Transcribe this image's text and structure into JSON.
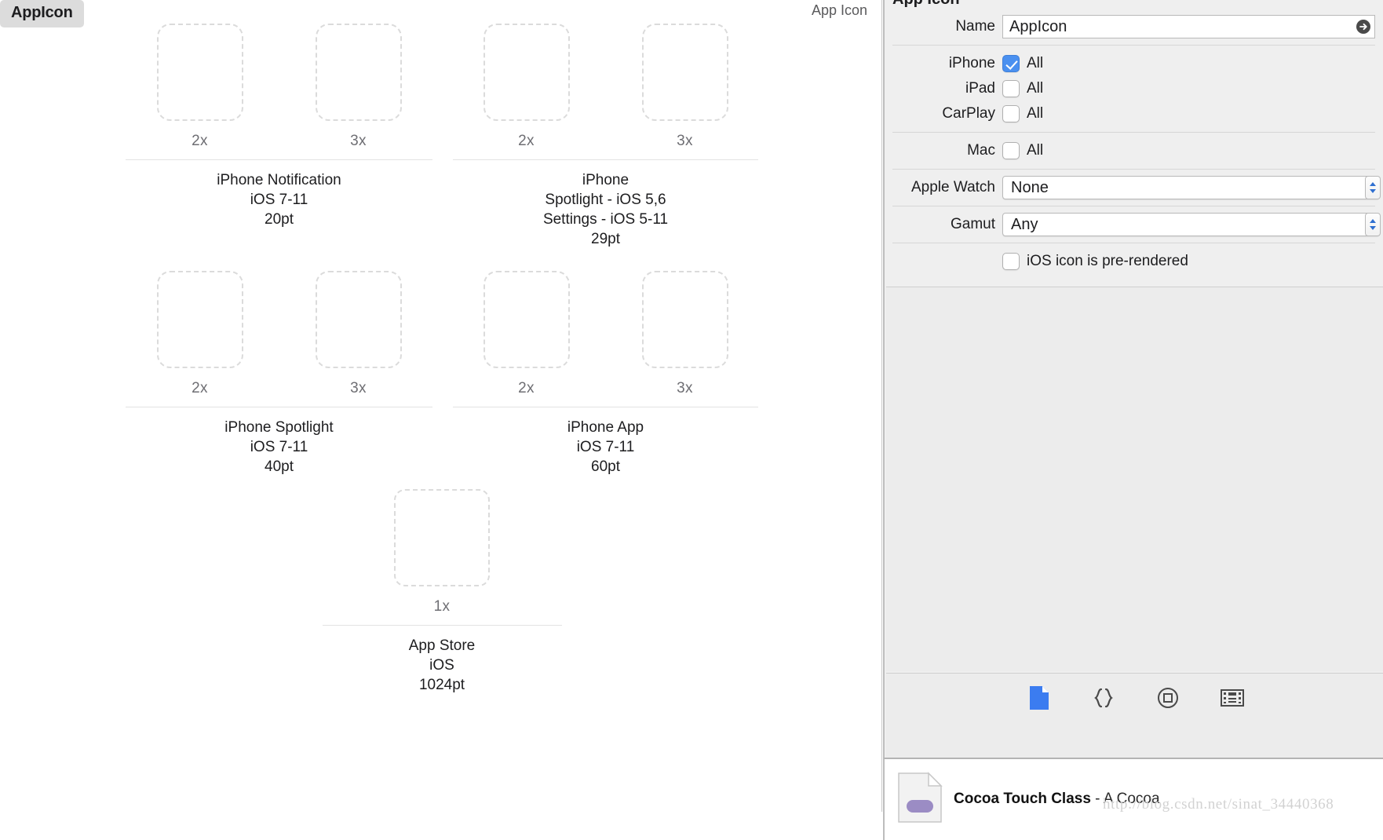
{
  "canvas": {
    "asset_chip_label": "AppIcon",
    "title": "App Icon",
    "groups": [
      {
        "id": "iphone-notification",
        "slots": [
          {
            "scale": "2x",
            "size": "small"
          },
          {
            "scale": "3x",
            "size": "small"
          }
        ],
        "caption_lines": [
          "iPhone Notification",
          "iOS 7-11",
          "20pt"
        ]
      },
      {
        "id": "iphone-spotlight-settings",
        "slots": [
          {
            "scale": "2x",
            "size": "small"
          },
          {
            "scale": "3x",
            "size": "small"
          }
        ],
        "caption_lines": [
          "iPhone",
          "Spotlight - iOS 5,6",
          "Settings - iOS 5-11",
          "29pt"
        ]
      },
      {
        "id": "iphone-spotlight",
        "slots": [
          {
            "scale": "2x",
            "size": "small"
          },
          {
            "scale": "3x",
            "size": "small"
          }
        ],
        "caption_lines": [
          "iPhone Spotlight",
          "iOS 7-11",
          "40pt"
        ]
      },
      {
        "id": "iphone-app",
        "slots": [
          {
            "scale": "2x",
            "size": "small"
          },
          {
            "scale": "3x",
            "size": "small"
          }
        ],
        "caption_lines": [
          "iPhone App",
          "iOS 7-11",
          "60pt"
        ]
      }
    ],
    "store_group": {
      "id": "app-store",
      "slots": [
        {
          "scale": "1x",
          "size": "big"
        }
      ],
      "caption_lines": [
        "App Store",
        "iOS",
        "1024pt"
      ]
    }
  },
  "inspector": {
    "header": "App Icon",
    "name_label": "Name",
    "name_value": "AppIcon",
    "devices": [
      {
        "label": "iPhone",
        "checked": true,
        "text": "All"
      },
      {
        "label": "iPad",
        "checked": false,
        "text": "All"
      },
      {
        "label": "CarPlay",
        "checked": false,
        "text": "All"
      },
      {
        "label": "Mac",
        "checked": false,
        "text": "All"
      }
    ],
    "popups": [
      {
        "label": "Apple Watch",
        "value": "None"
      },
      {
        "label": "Gamut",
        "value": "Any"
      }
    ],
    "prerendered": {
      "checked": false,
      "text": "iOS icon is pre-rendered"
    },
    "tabs": [
      {
        "name": "file-inspector-icon",
        "selected": true
      },
      {
        "name": "quick-help-braces-icon",
        "selected": false
      },
      {
        "name": "identity-target-icon",
        "selected": false
      },
      {
        "name": "media-library-film-icon",
        "selected": false
      }
    ],
    "accent_color": "#3b7cf0"
  },
  "library": {
    "item_title": "Cocoa Touch Class",
    "item_subtitle": " - A Cocoa"
  },
  "watermark": "http://blog.csdn.net/sinat_34440368"
}
